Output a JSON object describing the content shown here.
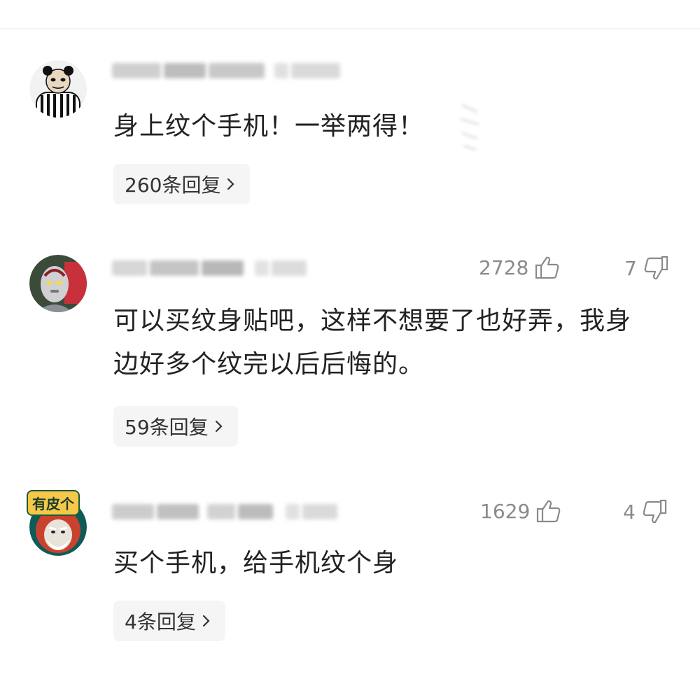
{
  "comments": [
    {
      "text": "身上纹个手机！一举两得！",
      "reply_label": "260条回复",
      "likes": null,
      "dislikes": null
    },
    {
      "text_line1": "可以买纹身贴吧，这样不想要了也好弄，我身",
      "text_line2": "边好多个纹完以后后悔的。",
      "reply_label": "59条回复",
      "likes": "2728",
      "dislikes": "7"
    },
    {
      "text": "买个手机，给手机纹个身",
      "reply_label": "4条回复",
      "likes": "1629",
      "dislikes": "4",
      "avatar_badge": "有皮个"
    }
  ],
  "icons": {
    "like": "thumbs-up-icon",
    "dislike": "thumbs-down-icon",
    "reply_chevron": "chevron-right-icon"
  },
  "colors": {
    "text": "#222222",
    "muted": "#8a8a8a",
    "pill_bg": "#f5f5f5"
  }
}
